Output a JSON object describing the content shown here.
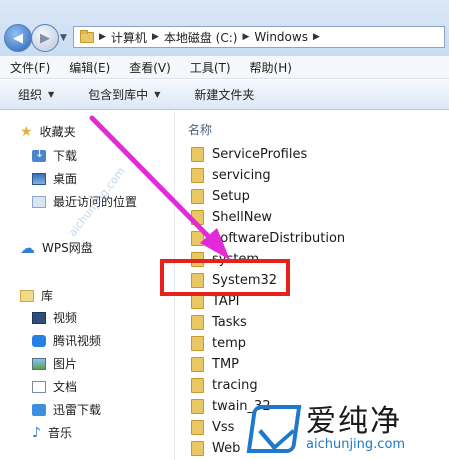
{
  "address_bar": {
    "crumbs": [
      "计算机",
      "本地磁盘 (C:)",
      "Windows"
    ]
  },
  "menu": [
    "文件(F)",
    "编辑(E)",
    "查看(V)",
    "工具(T)",
    "帮助(H)"
  ],
  "toolbar": {
    "organize": "组织",
    "include_in_library": "包含到库中",
    "new_folder": "新建文件夹"
  },
  "nav": {
    "favorites": "收藏夹",
    "downloads": "下载",
    "desktop": "桌面",
    "recent": "最近访问的位置",
    "wps": "WPS网盘",
    "libraries": "库",
    "videos": "视频",
    "tencent_video": "腾讯视频",
    "pictures": "图片",
    "documents": "文档",
    "xunlei": "迅雷下载",
    "music": "音乐"
  },
  "list": {
    "column_name": "名称",
    "folders": [
      "ServiceProfiles",
      "servicing",
      "Setup",
      "ShellNew",
      "SoftwareDistribution",
      "system",
      "System32",
      "TAPI",
      "Tasks",
      "temp",
      "TMP",
      "tracing",
      "twain_32",
      "Vss",
      "Web"
    ]
  },
  "watermark": {
    "brand": "爱纯净",
    "url": "aichunjing.com",
    "diagonal": "aichunjing.com"
  },
  "colors": {
    "highlight_border": "#e8211c",
    "arrow": "#e22ad8",
    "watermark_blue": "#1f78c9"
  }
}
